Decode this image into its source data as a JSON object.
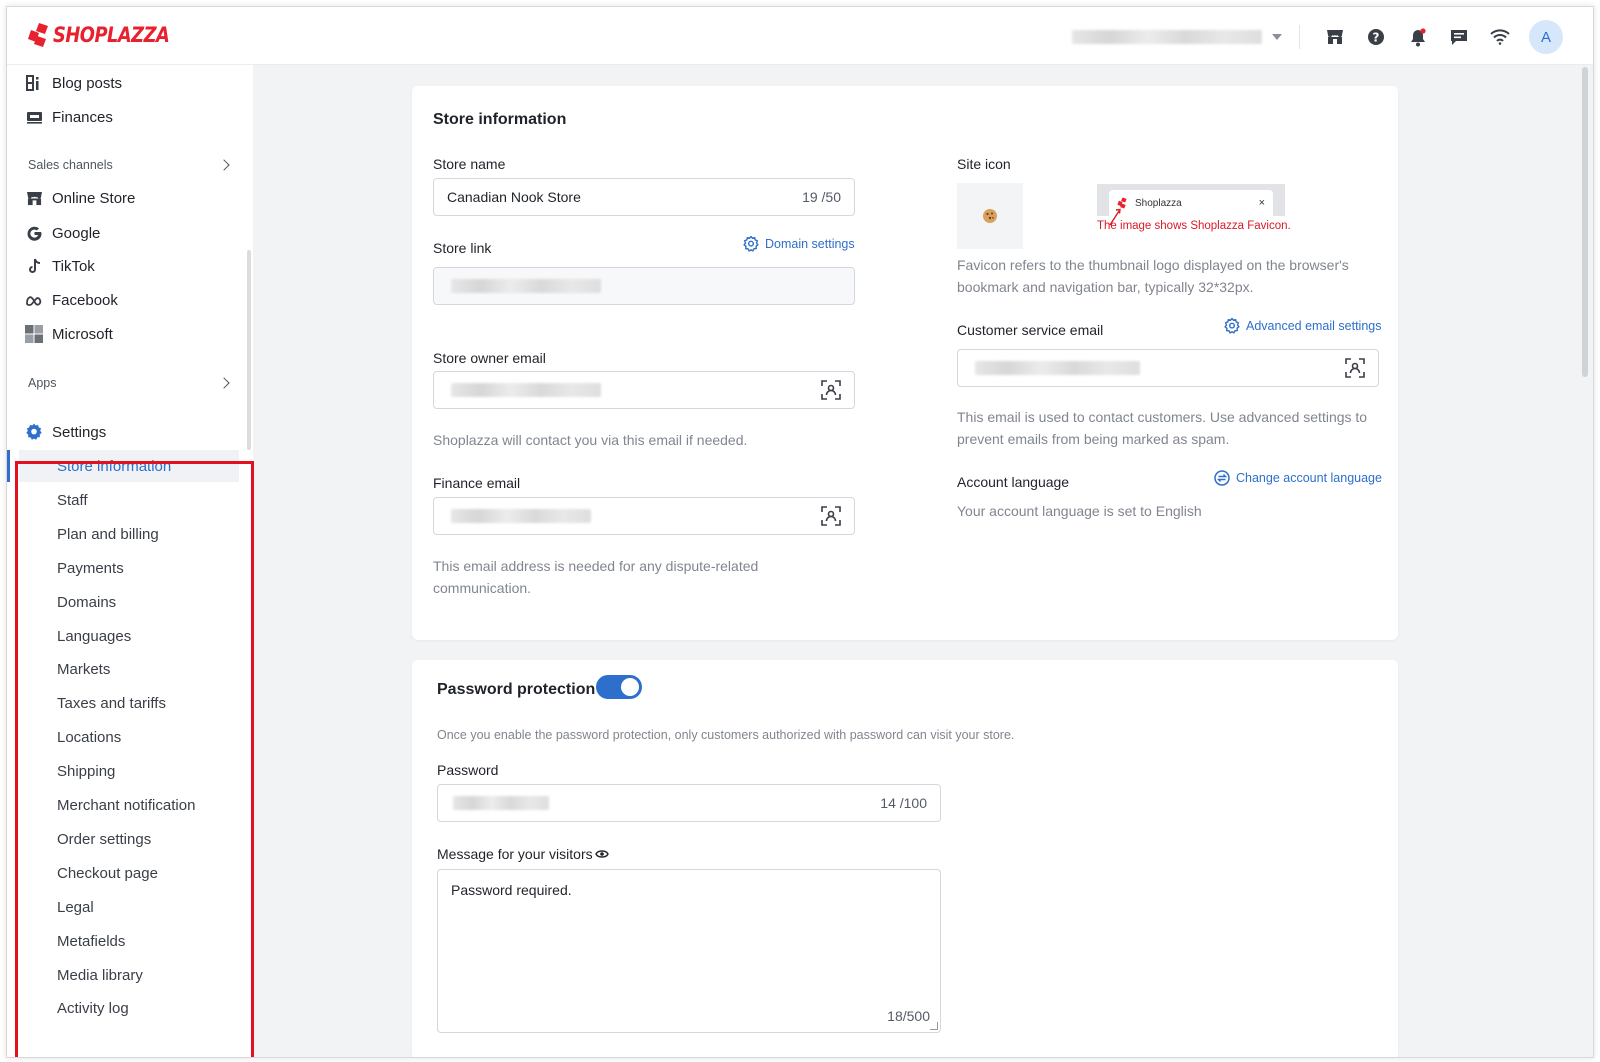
{
  "brand": {
    "name": "SHOPLAZZA",
    "color": "#e8212f"
  },
  "colors": {
    "accent": "#2d6fcb",
    "highlight": "#e4101e"
  },
  "topbar": {
    "icons": [
      "store-icon",
      "help-icon",
      "bell-icon",
      "chat-icon",
      "wifi-icon"
    ],
    "avatar_letter": "A"
  },
  "sidebar": {
    "top_items": [
      {
        "label": "Blog posts",
        "icon": "blog-icon"
      },
      {
        "label": "Finances",
        "icon": "finance-icon"
      }
    ],
    "sales_channels_label": "Sales channels",
    "channels": [
      {
        "label": "Online Store",
        "icon": "store-icon"
      },
      {
        "label": "Google",
        "icon": "google-icon"
      },
      {
        "label": "TikTok",
        "icon": "tiktok-icon"
      },
      {
        "label": "Facebook",
        "icon": "meta-icon"
      },
      {
        "label": "Microsoft",
        "icon": "microsoft-icon"
      }
    ],
    "apps_label": "Apps",
    "settings_label": "Settings",
    "settings_items": [
      "Store information",
      "Staff",
      "Plan and billing",
      "Payments",
      "Domains",
      "Languages",
      "Markets",
      "Taxes and tariffs",
      "Locations",
      "Shipping",
      "Merchant notification",
      "Order settings",
      "Checkout page",
      "Legal",
      "Metafields",
      "Media library",
      "Activity log"
    ],
    "active_item": "Store information"
  },
  "store_info": {
    "title": "Store information",
    "store_name_label": "Store name",
    "store_name_value": "Canadian Nook Store",
    "store_name_counter": "19 /50",
    "store_link_label": "Store link",
    "domain_settings_link": "Domain settings",
    "owner_email_label": "Store owner email",
    "owner_email_help": "Shoplazza will contact you via this email if needed.",
    "finance_email_label": "Finance email",
    "finance_email_help": "This email address is needed for any dispute-related communication.",
    "site_icon_label": "Site icon",
    "favicon_tab_title": "Shoplazza",
    "favicon_tab_close": "×",
    "favicon_note": "The image shows Shoplazza Favicon.",
    "favicon_help": "Favicon refers to the thumbnail logo displayed on the browser's bookmark and navigation bar, typically 32*32px.",
    "cs_email_label": "Customer service email",
    "advanced_email_link": "Advanced email settings",
    "cs_email_help": "This email is used to contact customers. Use advanced settings to prevent emails from being marked as spam.",
    "account_language_label": "Account language",
    "change_language_link": "Change account language",
    "account_language_help": "Your account language is set to English"
  },
  "password_protection": {
    "title": "Password protection",
    "enabled": true,
    "description": "Once you enable the password protection, only customers authorized with password can visit your store.",
    "password_label": "Password",
    "password_counter": "14 /100",
    "message_label": "Message for your visitors",
    "message_value": "Password required.",
    "message_counter": "18/500"
  }
}
